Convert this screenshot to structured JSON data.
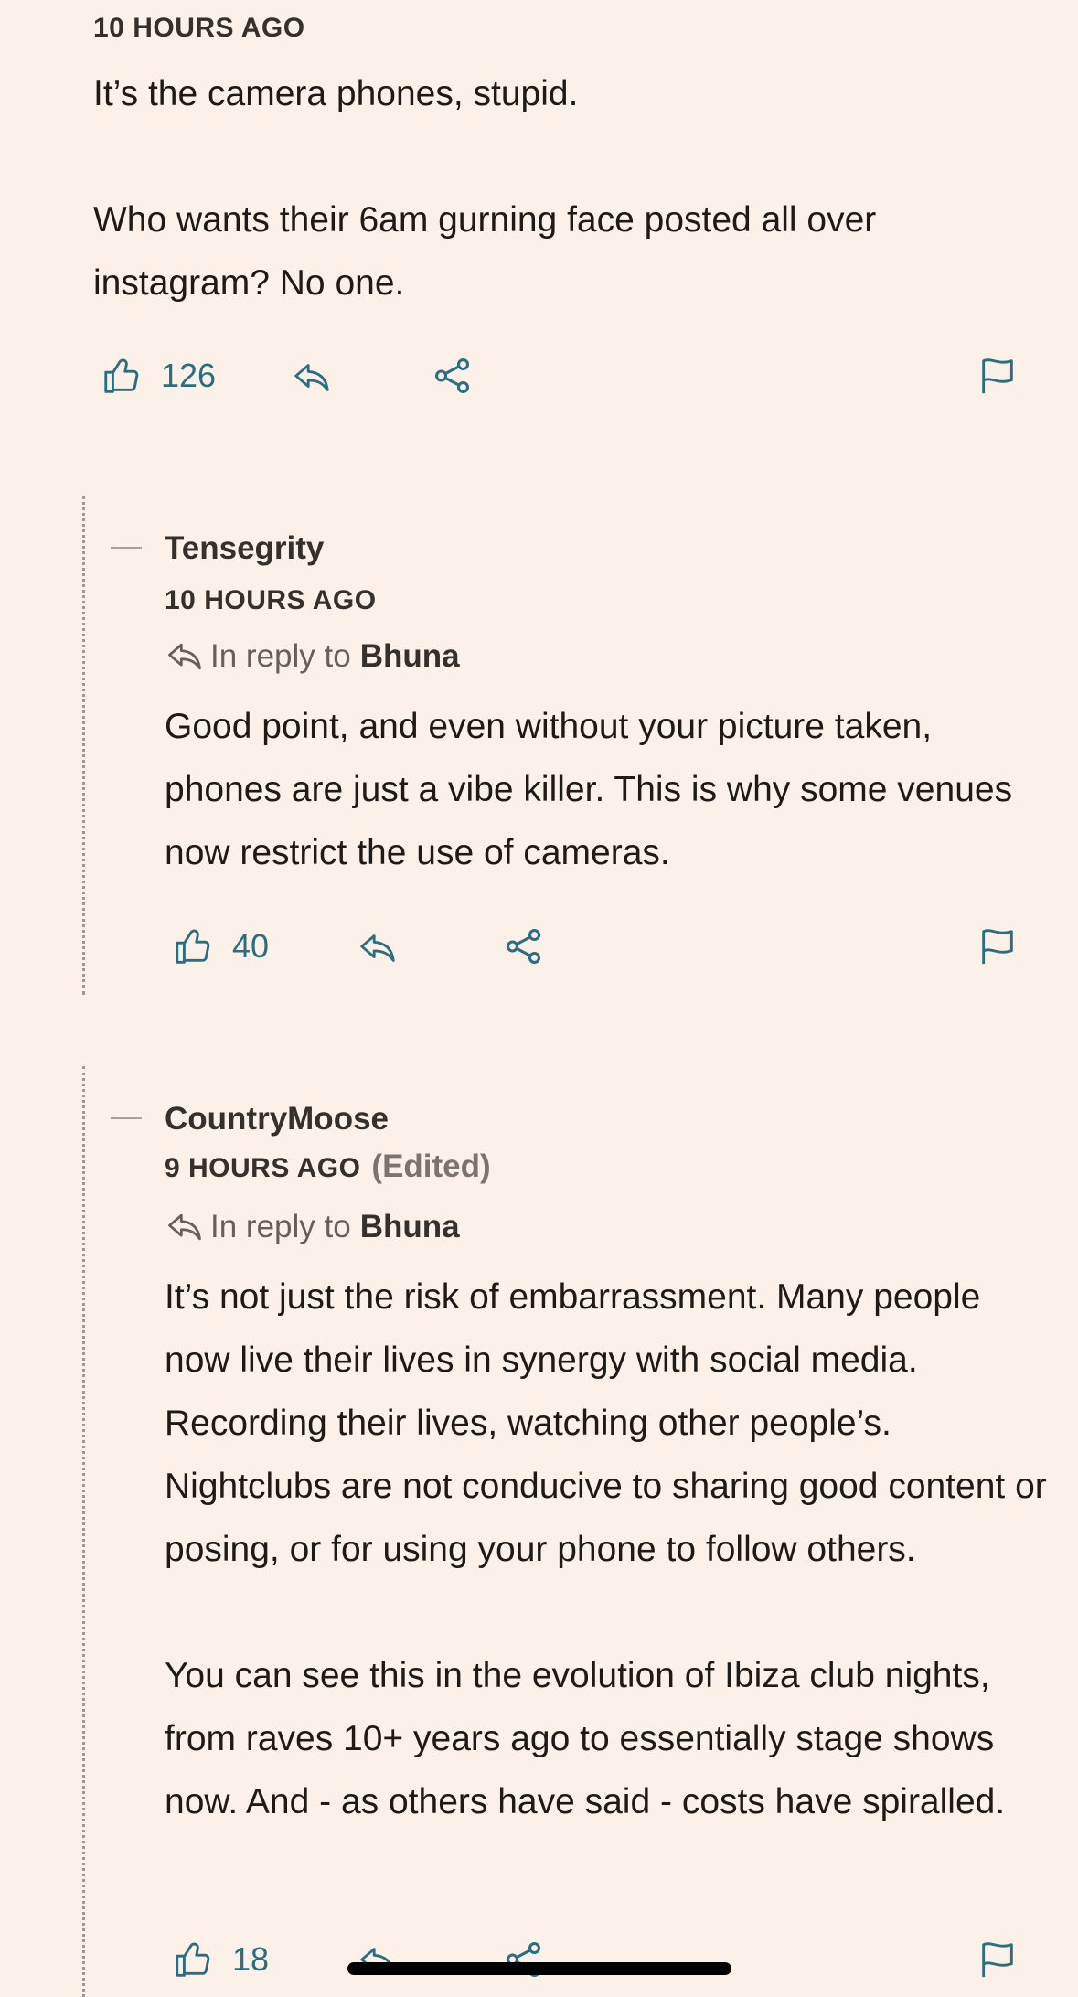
{
  "top_comment": {
    "time": "10 HOURS AGO",
    "paragraphs": [
      "It’s the camera phones, stupid.",
      "Who wants their 6am gurning face posted all over instagram? No one."
    ],
    "likes": "126"
  },
  "reply1": {
    "author": "Tensegrity",
    "time": "10 HOURS AGO",
    "reply_prefix": "In reply to",
    "reply_to": "Bhuna",
    "paragraphs": [
      "Good point, and even without your picture taken, phones are just a vibe killer. This is why some venues now restrict the use of cameras."
    ],
    "likes": "40"
  },
  "reply2": {
    "author": "CountryMoose",
    "time": "9 HOURS AGO",
    "edited": "(Edited)",
    "reply_prefix": "In reply to",
    "reply_to": "Bhuna",
    "paragraphs": [
      "It’s not just the risk of embarrassment. Many people now live their lives in synergy with social media. Recording their lives, watching other people’s. Nightclubs are not conducive to sharing good content or posing, or for using your phone to follow others.",
      "You can see this in the evolution of Ibiza club nights, from raves 10+ years ago to essentially stage shows now. And - as others have said - costs have spiralled."
    ],
    "likes": "18"
  },
  "colors": {
    "background": "#FCF1E8",
    "accent": "#2C6D80",
    "text": "#1E1A17"
  }
}
